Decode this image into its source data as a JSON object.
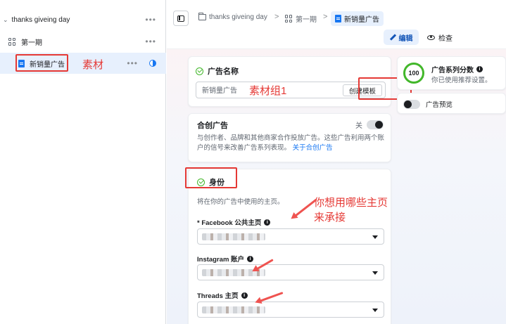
{
  "sidebar": {
    "campaign": {
      "label": "thanks giveing day",
      "menu": "•••"
    },
    "adset": {
      "label": "第一期",
      "menu": "•••"
    },
    "ad": {
      "label": "新销量广告",
      "menu": "•••"
    }
  },
  "topbar": {
    "breadcrumb": [
      {
        "label": "thanks giveing day"
      },
      {
        "label": "第一期"
      },
      {
        "label": "新销量广告"
      }
    ],
    "separator": ">",
    "edit_label": "编辑",
    "review_label": "检查"
  },
  "ad_name": {
    "title": "广告名称",
    "value": "新销量广告",
    "template_button": "创建模板"
  },
  "collab": {
    "title": "合创广告",
    "toggle_label": "关",
    "description": "与创作者、品牌和其他商家合作投放广告。这些广告利用两个账户的信号来改善广告系列表现。",
    "link": "关于合创广告"
  },
  "identity": {
    "title": "身份",
    "description": "将在你的广告中使用的主页。",
    "facebook_label": "* Facebook 公共主页",
    "instagram_label": "Instagram 账户",
    "threads_label": "Threads 主页"
  },
  "score": {
    "value": "100",
    "title": "广告系列分数",
    "subtitle": "你已使用推荐设置。"
  },
  "preview": {
    "label": "广告预览"
  },
  "annotations": {
    "material": "素材",
    "material_group": "素材组1",
    "question": "你想用哪些主页来承接"
  },
  "colors": {
    "accent": "#1877f2",
    "annotation": "#e53935",
    "success": "#42b72a"
  }
}
